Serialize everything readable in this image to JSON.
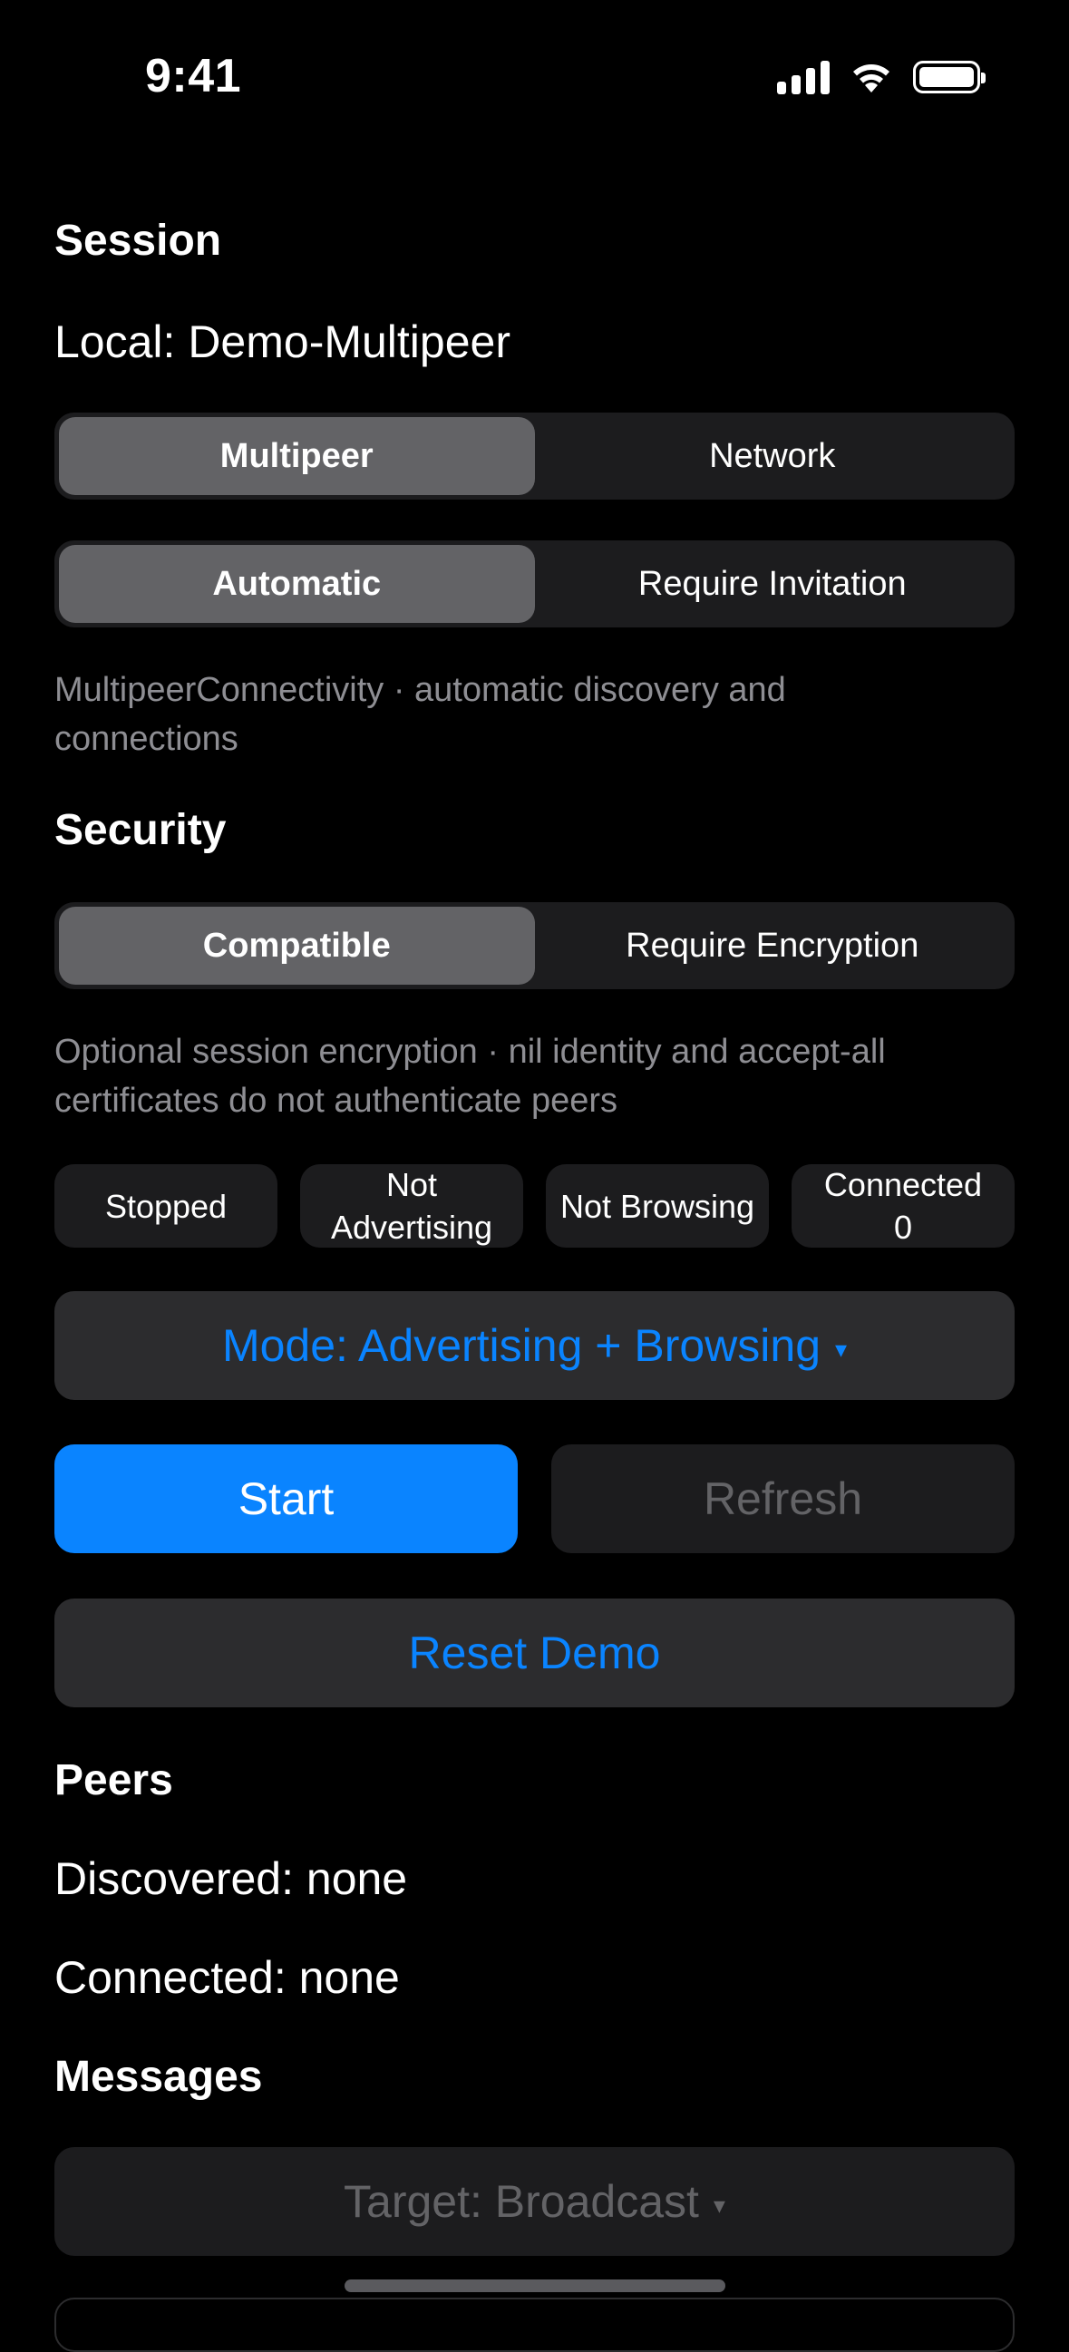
{
  "status_bar": {
    "time": "9:41",
    "icons": [
      "cellular-signal-icon",
      "wifi-icon",
      "battery-icon"
    ]
  },
  "session": {
    "title": "Session",
    "local_name": "Local: Demo-Multipeer",
    "transport_control": {
      "options": [
        "Multipeer",
        "Network"
      ],
      "selected": "Multipeer"
    },
    "connection_control": {
      "options": [
        "Automatic",
        "Require Invitation"
      ],
      "selected": "Automatic"
    },
    "description": "MultipeerConnectivity · automatic discovery and connections"
  },
  "security": {
    "title": "Security",
    "control": {
      "options": [
        "Compatible",
        "Require Encryption"
      ],
      "selected": "Compatible"
    },
    "description": "Optional session encryption · nil identity and accept-all certificates do not authenticate peers"
  },
  "status_chips": {
    "state": "Stopped",
    "advertising": "Not\nAdvertising",
    "browsing": "Not Browsing",
    "connected": "Connected\n0"
  },
  "controls": {
    "mode_label": "Mode: Advertising + Browsing",
    "mode_caret": "▾",
    "start_label": "Start",
    "refresh_label": "Refresh",
    "reset_label": "Reset Demo"
  },
  "peers": {
    "title": "Peers",
    "discovered": "Discovered: none",
    "connected": "Connected: none"
  },
  "messages": {
    "title": "Messages",
    "target_label": "Target: Broadcast",
    "target_caret": "▾"
  },
  "colors": {
    "background": "#000000",
    "accent": "#0a84ff",
    "secondary_text": "#8e8e93",
    "control_background": "#1c1c1e",
    "selected_segment": "#636366"
  }
}
